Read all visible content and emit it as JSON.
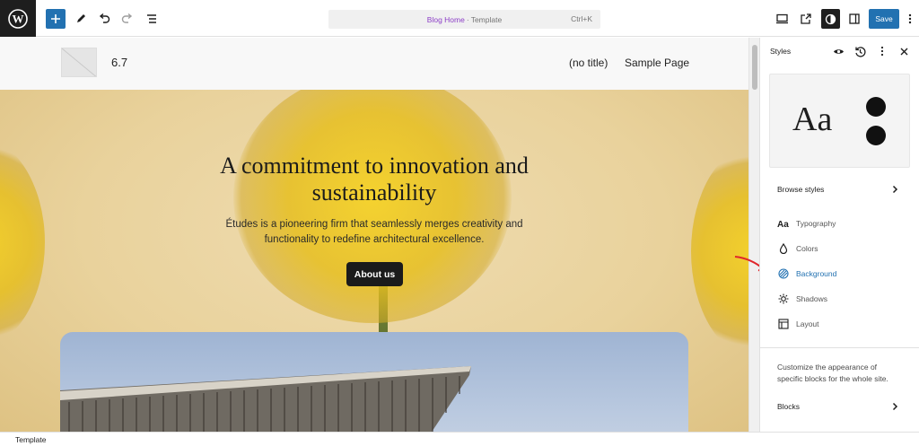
{
  "toolbar": {
    "document_title": "Blog Home",
    "separator": "·",
    "document_type": "Template",
    "shortcut": "Ctrl+K",
    "save_label": "Save"
  },
  "site": {
    "title": "6.7",
    "nav": [
      "(no title)",
      "Sample Page"
    ]
  },
  "hero": {
    "heading": "A commitment to innovation and sustainability",
    "text": "Études is a pioneering firm that seamlessly merges creativity and functionality to redefine architectural excellence.",
    "button_label": "About us"
  },
  "sidebar": {
    "title": "Styles",
    "preview_text": "Aa",
    "browse_label": "Browse styles",
    "items": [
      {
        "label": "Typography",
        "icon": "typography-icon"
      },
      {
        "label": "Colors",
        "icon": "colors-icon"
      },
      {
        "label": "Background",
        "icon": "background-icon",
        "active": true
      },
      {
        "label": "Shadows",
        "icon": "shadows-icon"
      },
      {
        "label": "Layout",
        "icon": "layout-icon"
      }
    ],
    "description": "Customize the appearance of specific blocks for the whole site.",
    "blocks_label": "Blocks"
  },
  "footer": {
    "breadcrumb": "Template"
  },
  "colors": {
    "accent": "#2271b1",
    "active_item": "#2271b1",
    "title_link": "#8c3ec7",
    "annotation_arrow": "#e0262b"
  }
}
